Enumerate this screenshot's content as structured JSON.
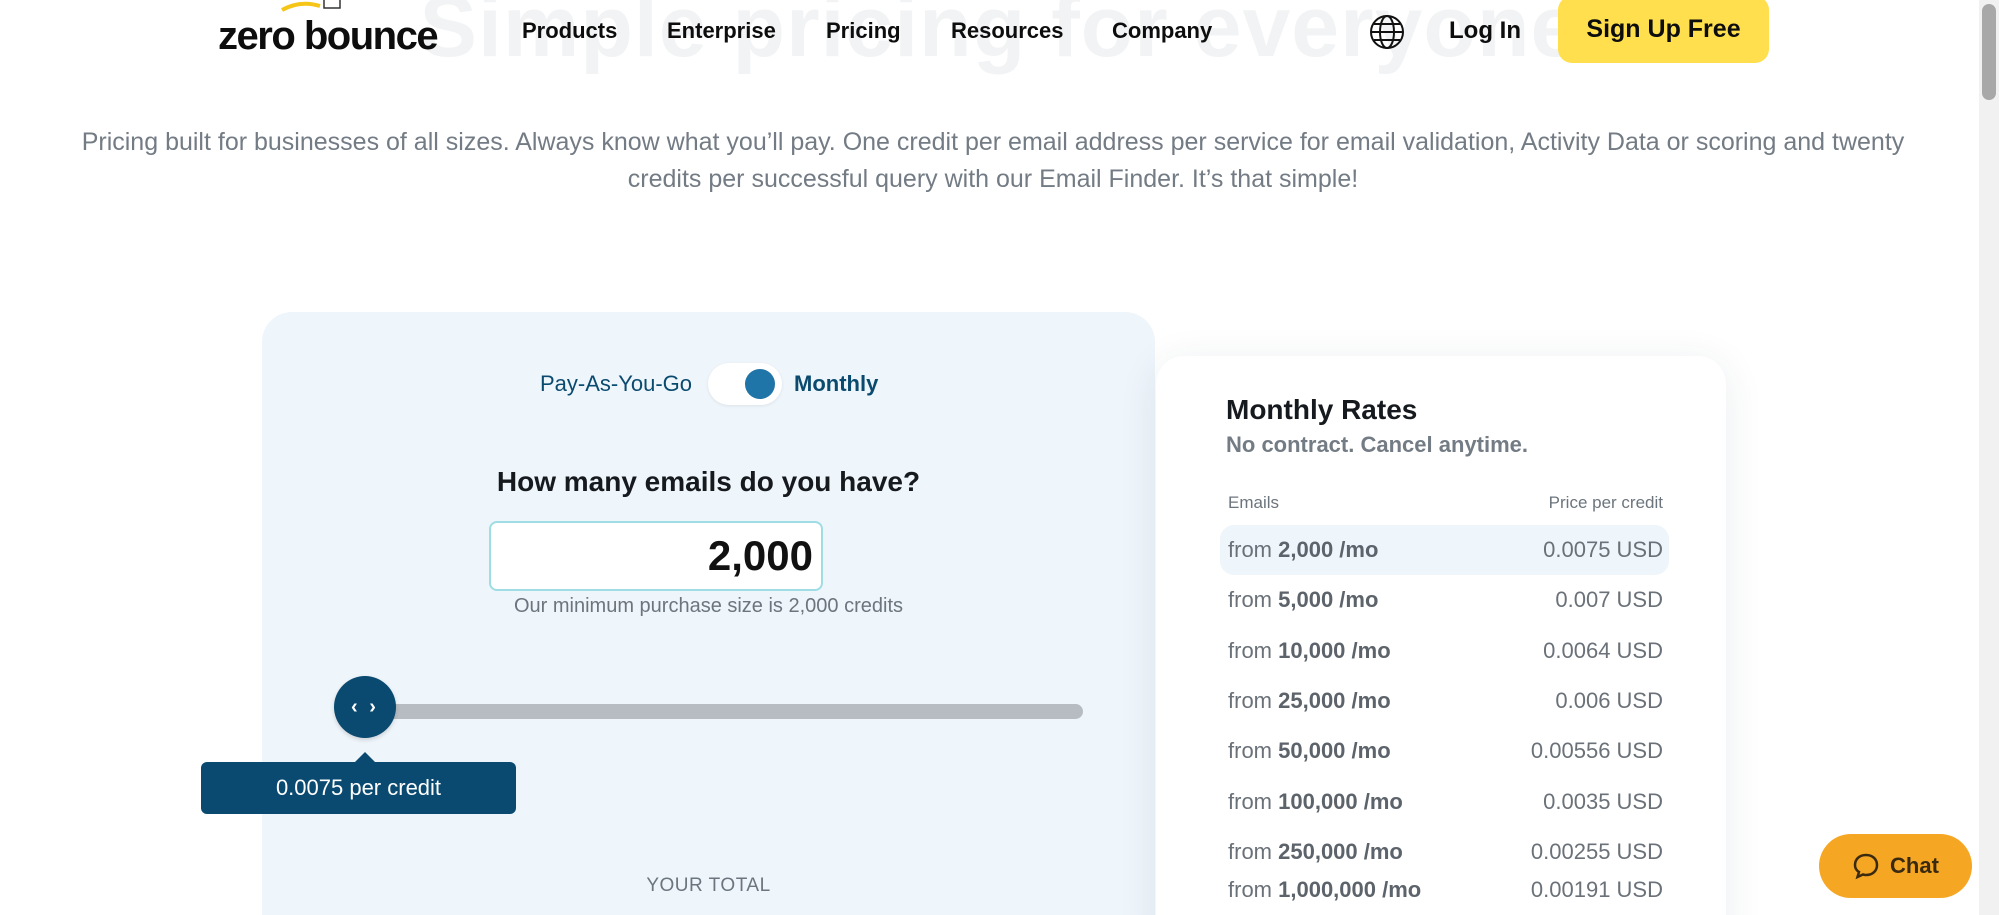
{
  "hero": {
    "background_title": "Simple pricing for everyone"
  },
  "header": {
    "logo_text": "zero bounce",
    "nav": [
      "Products",
      "Enterprise",
      "Pricing",
      "Resources",
      "Company"
    ],
    "language_icon": "globe-icon",
    "login_label": "Log In",
    "signup_label": "Sign Up Free"
  },
  "subtitle": "Pricing built for businesses of all sizes. Always know what you’ll pay. One credit per email address per service for email validation, Activity Data or scoring and twenty credits per successful query with our Email Finder. It’s that simple!",
  "calculator": {
    "toggle": {
      "left_label": "Pay-As-You-Go",
      "right_label": "Monthly",
      "selected": "Monthly"
    },
    "question": "How many emails do you have?",
    "email_count": "2,000",
    "min_note": "Our minimum purchase size is 2,000 credits",
    "slider": {
      "handle_glyph": "‹ ›",
      "position_fraction": 0
    },
    "tooltip": "0.0075 per credit",
    "total_label": "YOUR TOTAL"
  },
  "rates": {
    "title": "Monthly Rates",
    "subtitle": "No contract. Cancel anytime.",
    "col_emails": "Emails",
    "col_price": "Price per credit",
    "prefix": "from",
    "rows": [
      {
        "emails": "2,000 /mo",
        "price": "0.0075 USD"
      },
      {
        "emails": "5,000 /mo",
        "price": "0.007 USD"
      },
      {
        "emails": "10,000 /mo",
        "price": "0.0064 USD"
      },
      {
        "emails": "25,000 /mo",
        "price": "0.006 USD"
      },
      {
        "emails": "50,000 /mo",
        "price": "0.00556 USD"
      },
      {
        "emails": "100,000 /mo",
        "price": "0.0035 USD"
      },
      {
        "emails": "250,000 /mo",
        "price": "0.00255 USD"
      },
      {
        "emails": "1,000,000 /mo",
        "price": "0.00191 USD"
      }
    ]
  },
  "chat": {
    "label": "Chat",
    "icon": "chat-bubble-icon"
  },
  "colors": {
    "brand_yellow": "#ffdf4d",
    "navy": "#0a4a70",
    "chat_orange": "#f5a623",
    "card_bg": "#eef5fb"
  }
}
